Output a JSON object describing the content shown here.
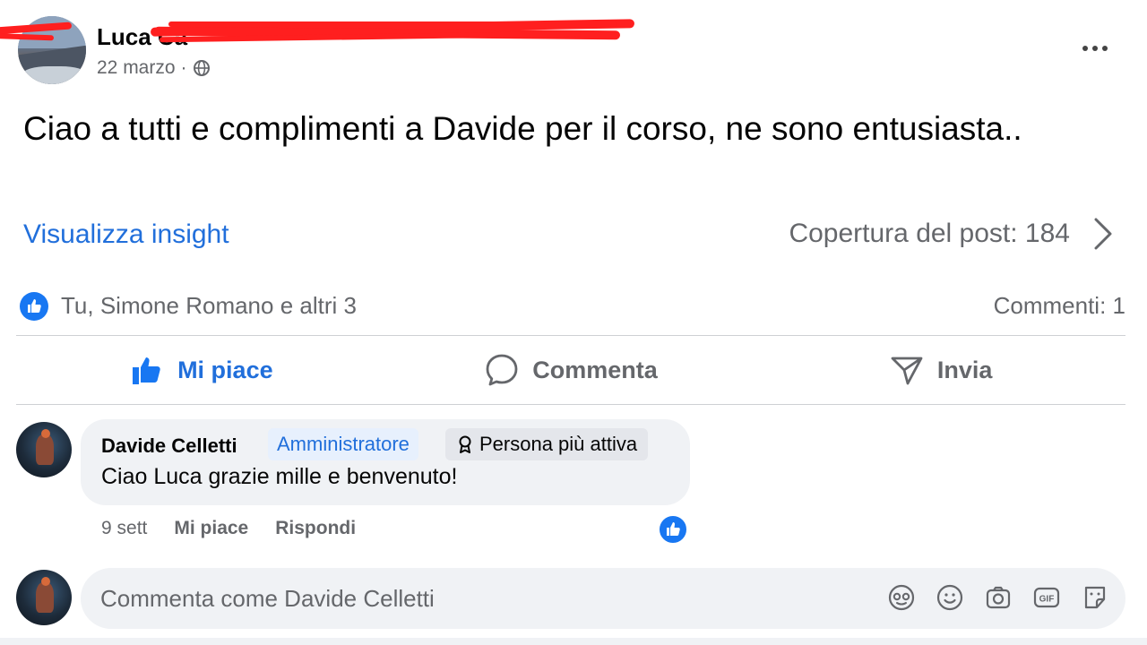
{
  "post": {
    "author_name": "Luca Ca",
    "date": "22 marzo",
    "separator": "·",
    "visibility_icon": "globe-icon",
    "more_icon": "more-options-icon",
    "text": "Ciao a tutti e complimenti a Davide per il corso, ne sono entusiasta.."
  },
  "insights": {
    "link_label": "Visualizza insight",
    "reach_label": "Copertura del post: 184"
  },
  "reactions": {
    "summary": "Tu, Simone Romano e altri 3",
    "comments_count": "Commenti: 1"
  },
  "actions": {
    "like": "Mi piace",
    "comment": "Commenta",
    "send": "Invia"
  },
  "comment": {
    "author": "Davide Celletti",
    "role_badge": "Amministratore",
    "activity_badge": "Persona più attiva",
    "text": "Ciao Luca grazie mille e benvenuto!",
    "time": "9 sett",
    "like_label": "Mi piace",
    "reply_label": "Rispondi"
  },
  "composer": {
    "placeholder": "Commenta come Davide Celletti",
    "tools": [
      "avatar-sticker-icon",
      "emoji-icon",
      "camera-icon",
      "gif-icon",
      "sticker-icon"
    ]
  },
  "colors": {
    "accent_blue": "#216fdb",
    "secondary_text": "#65676b",
    "bubble_bg": "#f0f2f5",
    "redaction_red": "#ff1f1f"
  }
}
